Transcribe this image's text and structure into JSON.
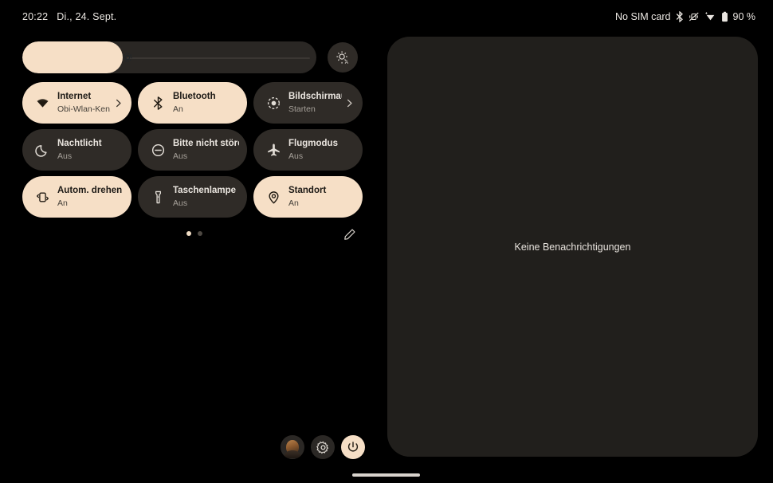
{
  "statusbar": {
    "time": "20:22",
    "date": "Di., 24. Sept.",
    "sim_text": "No SIM card",
    "battery_text": "90 %",
    "icons": [
      "bluetooth-icon",
      "vibrate-off-icon",
      "wifi-icon",
      "battery-icon"
    ]
  },
  "brightness": {
    "name": "brightness-slider",
    "level_percent": 34,
    "icon": "brightness-icon",
    "auto_button_icon": "auto-brightness-icon"
  },
  "tiles": [
    {
      "title": "Internet",
      "subtitle": "Obi-Wlan-Ken..",
      "state": "on",
      "icon": "wifi-icon",
      "chevron": true
    },
    {
      "title": "Bluetooth",
      "subtitle": "An",
      "state": "on",
      "icon": "bluetooth-icon",
      "chevron": false
    },
    {
      "title": "Bildschirmau..",
      "subtitle": "Starten",
      "state": "off",
      "icon": "screen-record-icon",
      "chevron": true
    },
    {
      "title": "Nachtlicht",
      "subtitle": "Aus",
      "state": "off",
      "icon": "moon-icon",
      "chevron": false
    },
    {
      "title": "Bitte nicht stören",
      "subtitle": "Aus",
      "state": "off",
      "icon": "do-not-disturb-icon",
      "chevron": false
    },
    {
      "title": "Flugmodus",
      "subtitle": "Aus",
      "state": "off",
      "icon": "airplane-icon",
      "chevron": false
    },
    {
      "title": "Autom. drehen",
      "subtitle": "An",
      "state": "on",
      "icon": "auto-rotate-icon",
      "chevron": false
    },
    {
      "title": "Taschenlampe",
      "subtitle": "Aus",
      "state": "off",
      "icon": "flashlight-icon",
      "chevron": false
    },
    {
      "title": "Standort",
      "subtitle": "An",
      "state": "on",
      "icon": "location-icon",
      "chevron": false
    }
  ],
  "pager": {
    "pages": 2,
    "active_page": 1,
    "edit_icon": "pencil-icon"
  },
  "notifications": {
    "empty_text": "Keine Benachrichtigungen"
  },
  "bottom_actions": [
    {
      "name": "user-avatar-button",
      "icon": "avatar-icon"
    },
    {
      "name": "settings-button",
      "icon": "gear-icon"
    },
    {
      "name": "power-button",
      "icon": "power-icon"
    }
  ],
  "colors": {
    "background": "#000000",
    "accent": "#f6dfc6",
    "tile_off": "#2f2b27",
    "panel": "#211f1c",
    "text_light": "#eae5df",
    "text_dark": "#1d1a16"
  }
}
